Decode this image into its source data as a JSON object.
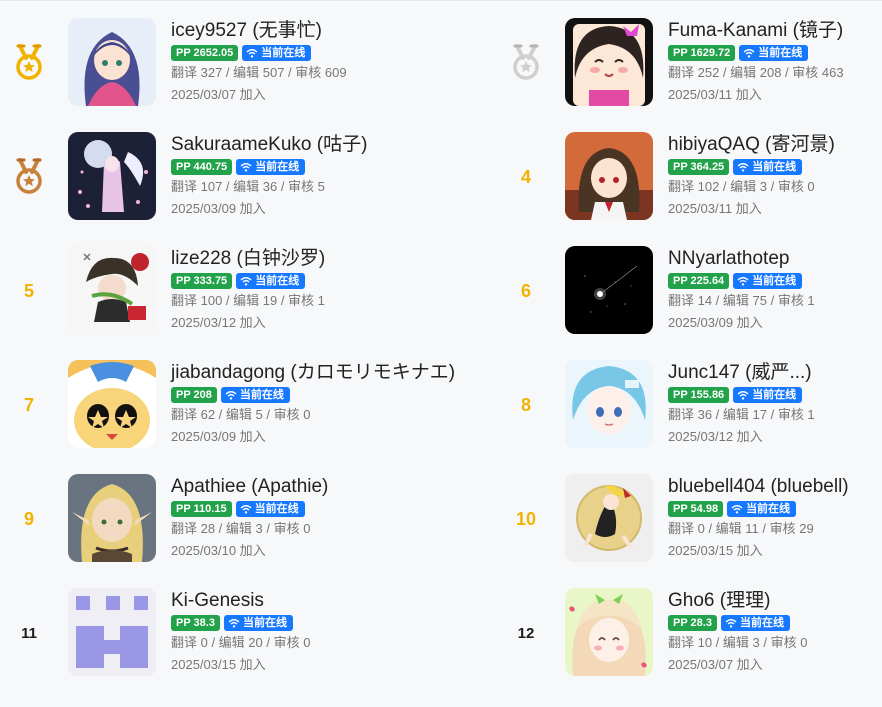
{
  "online_label": "当前在线",
  "icons": {
    "medal": "medal-icon",
    "wifi": "wifi-icon"
  },
  "colors": {
    "pp_badge": "#22a24a",
    "online_badge": "#1677ff",
    "gold": "#f0b400",
    "silver": "#c8c8c8",
    "bronze": "#c7813a"
  },
  "users": [
    {
      "rank": "1",
      "medal": "gold",
      "name": "icey9527 (无事忙)",
      "pp": "PP 2652.05",
      "stats": "翻译 327 / 编辑 507 / 审核 609",
      "joined": "2025/03/07 加入"
    },
    {
      "rank": "2",
      "medal": "silver",
      "name": "Fuma-Kanami (镜子)",
      "pp": "PP 1629.72",
      "stats": "翻译 252 / 编辑 208 / 审核 463",
      "joined": "2025/03/11 加入"
    },
    {
      "rank": "3",
      "medal": "bronze",
      "name": "SakuraameKuko (咕子)",
      "pp": "PP 440.75",
      "stats": "翻译 107 / 编辑 36 / 审核 5",
      "joined": "2025/03/09 加入"
    },
    {
      "rank": "4",
      "medal": "",
      "name": "hibiyaQAQ (寄河景)",
      "pp": "PP 364.25",
      "stats": "翻译 102 / 编辑 3 / 审核 0",
      "joined": "2025/03/11 加入"
    },
    {
      "rank": "5",
      "medal": "",
      "name": "lize228 (白钟沙罗)",
      "pp": "PP 333.75",
      "stats": "翻译 100 / 编辑 19 / 审核 1",
      "joined": "2025/03/12 加入"
    },
    {
      "rank": "6",
      "medal": "",
      "name": "NNyarlathotep",
      "pp": "PP 225.64",
      "stats": "翻译 14 / 编辑 75 / 审核 1",
      "joined": "2025/03/09 加入"
    },
    {
      "rank": "7",
      "medal": "",
      "name": "jiabandagong (カロモリモキナエ)",
      "pp": "PP 208",
      "stats": "翻译 62 / 编辑 5 / 审核 0",
      "joined": "2025/03/09 加入"
    },
    {
      "rank": "8",
      "medal": "",
      "name": "Junc147 (威严...)",
      "pp": "PP 155.86",
      "stats": "翻译 36 / 编辑 17 / 审核 1",
      "joined": "2025/03/12 加入"
    },
    {
      "rank": "9",
      "medal": "",
      "name": "Apathiee (Apathie)",
      "pp": "PP 110.15",
      "stats": "翻译 28 / 编辑 3 / 审核 0",
      "joined": "2025/03/10 加入"
    },
    {
      "rank": "10",
      "medal": "",
      "name": "bluebell404 (bluebell)",
      "pp": "PP 54.98",
      "stats": "翻译 0 / 编辑 11 / 审核 29",
      "joined": "2025/03/15 加入"
    },
    {
      "rank": "11",
      "medal": "",
      "name": "Ki-Genesis",
      "pp": "PP 38.3",
      "stats": "翻译 0 / 编辑 20 / 审核 0",
      "joined": "2025/03/15 加入"
    },
    {
      "rank": "12",
      "medal": "",
      "name": "Gho6 (理理)",
      "pp": "PP 28.3",
      "stats": "翻译 10 / 编辑 3 / 审核 0",
      "joined": "2025/03/07 加入"
    }
  ]
}
